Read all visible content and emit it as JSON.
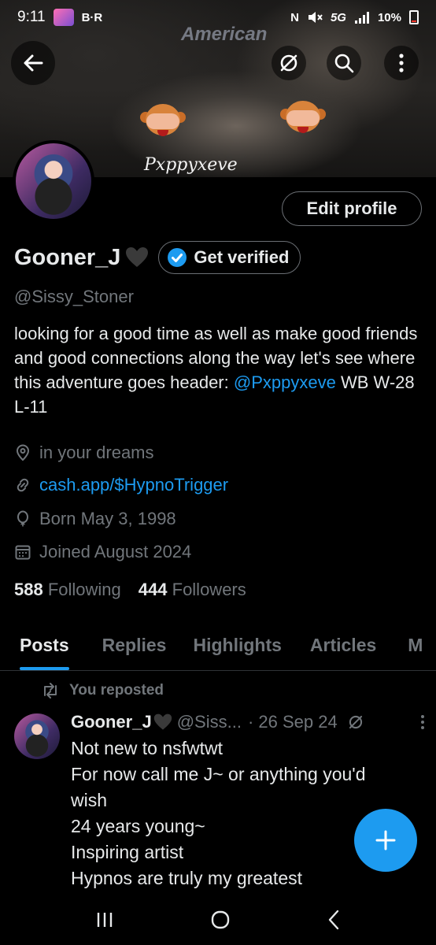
{
  "status_bar": {
    "time": "9:11",
    "app_label": "B·R",
    "network": "5G",
    "battery": "10%"
  },
  "header": {
    "brand_text": "American",
    "signature": "Pxppyxeve"
  },
  "profile": {
    "edit_label": "Edit profile",
    "display_name": "Gooner_J",
    "verify_label": "Get verified",
    "handle": "@Sissy_Stoner",
    "bio_text": "looking for a good time as well as make good friends and good connections along the way let's see where this adventure goes header:",
    "bio_mention": "@Pxppyxeve",
    "bio_tail": " WB  W-28 L-11",
    "location": "in your dreams",
    "website": "cash.app/$HypnoTrigger",
    "birthday": "Born May 3, 1998",
    "joined": "Joined August 2024",
    "following_count": "588",
    "following_label": "Following",
    "followers_count": "444",
    "followers_label": "Followers"
  },
  "tabs": [
    "Posts",
    "Replies",
    "Highlights",
    "Articles",
    "M"
  ],
  "active_tab": "Posts",
  "post": {
    "repost_label": "You reposted",
    "author_name": "Gooner_J",
    "author_handle": "@Siss...",
    "date": "· 26 Sep 24",
    "lines": [
      "Not new to nsfwtwt",
      "For now call me J~ or anything you'd",
      "wish",
      "24 years young~",
      "Inspiring artist",
      "Hypnos are truly my greatest"
    ]
  },
  "colors": {
    "accent": "#1d9bf0",
    "muted_text": "#71767b",
    "primary_text": "#e7e9ea",
    "background": "#000000"
  }
}
